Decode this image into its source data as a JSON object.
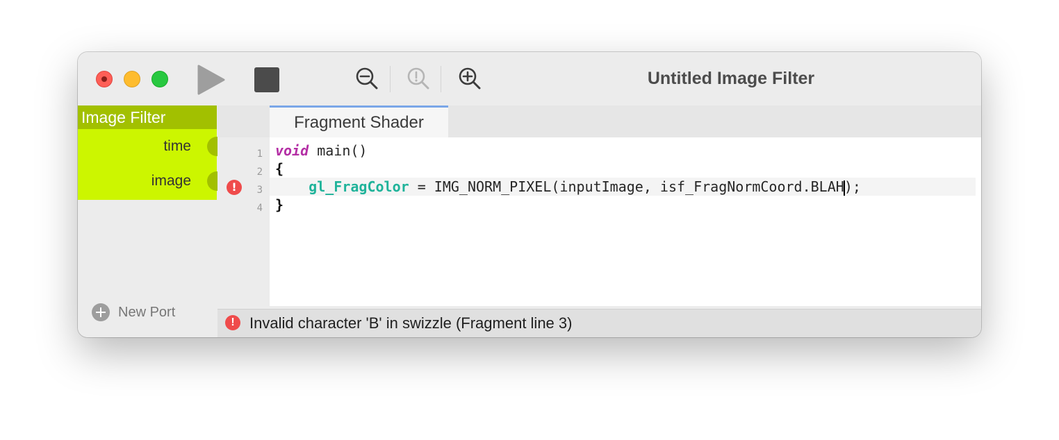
{
  "window": {
    "title": "Untitled Image Filter"
  },
  "toolbar": {
    "play": "play-icon",
    "stop": "stop-icon",
    "zoom_out": "zoom-out-icon",
    "zoom_reset": "zoom-reset-icon",
    "zoom_in": "zoom-in-icon"
  },
  "node": {
    "title": "Image Filter",
    "ports": [
      {
        "label": "time"
      },
      {
        "label": "image"
      }
    ],
    "new_port_label": "New Port"
  },
  "editor": {
    "tab_label": "Fragment Shader",
    "line_numbers": [
      "1",
      "2",
      "3",
      "4"
    ],
    "error_line": "3",
    "line1": {
      "kw": "void",
      "rest": " main()"
    },
    "line2": "{",
    "line3": {
      "indent": "    ",
      "builtin": "gl_FragColor",
      "before_caret": " = IMG_NORM_PIXEL(inputImage, isf_FragNormCoord.BLAH",
      "after_caret": ");"
    },
    "line4": "}"
  },
  "status": {
    "message": "Invalid character 'B' in swizzle (Fragment line 3)"
  },
  "colors": {
    "node_header": "#a2c000",
    "node_body": "#ccf600",
    "error": "#ef4b4b",
    "keyword": "#b42fa5",
    "builtin": "#1fb39a",
    "tab_accent": "#7aa6e8"
  }
}
